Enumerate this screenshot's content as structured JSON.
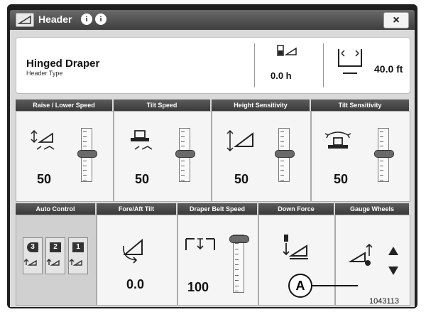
{
  "window": {
    "title": "Header",
    "info_icons": [
      "info-icon",
      "info-icon"
    ],
    "close_label": "×"
  },
  "summary": {
    "name": "Hinged Draper",
    "subtitle": "Header Type",
    "hours": "0.0 h",
    "width": "40.0 ft"
  },
  "row1": [
    {
      "label": "Raise / Lower Speed",
      "value": "50",
      "icon": "raise-lower-speed-icon",
      "slider_level": 0.55
    },
    {
      "label": "Tilt Speed",
      "value": "50",
      "icon": "tilt-speed-icon",
      "slider_level": 0.55
    },
    {
      "label": "Height Sensitivity",
      "value": "50",
      "icon": "height-sensitivity-icon",
      "slider_level": 0.55
    },
    {
      "label": "Tilt Sensitivity",
      "value": "50",
      "icon": "tilt-sensitivity-icon",
      "slider_level": 0.55
    }
  ],
  "row2": {
    "auto_control": {
      "label": "Auto Control",
      "badges": [
        "3",
        "2",
        "1"
      ]
    },
    "fore_aft": {
      "label": "Fore/Aft Tilt",
      "value": "0.0"
    },
    "draper_belt": {
      "label": "Draper Belt Speed",
      "value": "100"
    },
    "down_force": {
      "label": "Down Force"
    },
    "gauge_wheels": {
      "label": "Gauge Wheels"
    }
  },
  "annotations": {
    "callout": "A",
    "figure_id": "1043113"
  }
}
